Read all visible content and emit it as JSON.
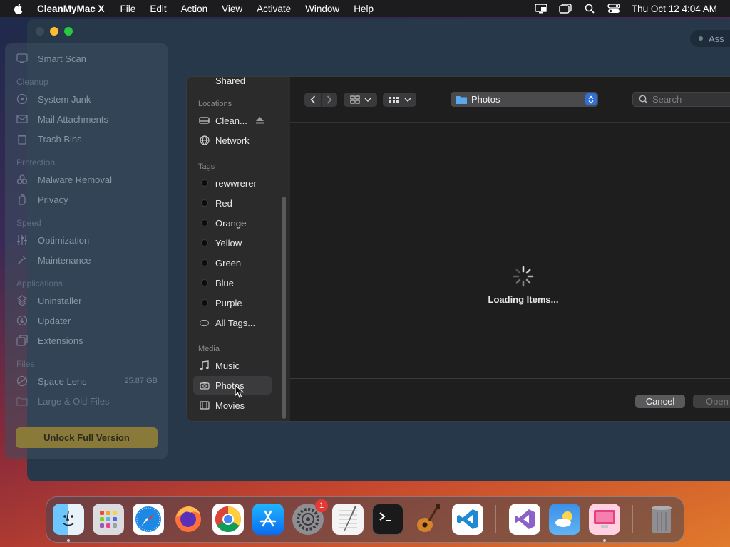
{
  "menubar": {
    "app_name": "CleanMyMac X",
    "menus": [
      "File",
      "Edit",
      "Action",
      "View",
      "Activate",
      "Window",
      "Help"
    ],
    "clock": "Thu Oct 12  4:04 AM"
  },
  "app": {
    "assistant_label": "Ass",
    "sidebar": {
      "smart_scan": "Smart Scan",
      "sections": {
        "cleanup": "Cleanup",
        "protection": "Protection",
        "speed": "Speed",
        "applications": "Applications",
        "files": "Files"
      },
      "items": {
        "system_junk": "System Junk",
        "mail_attachments": "Mail Attachments",
        "trash_bins": "Trash Bins",
        "malware_removal": "Malware Removal",
        "privacy": "Privacy",
        "optimization": "Optimization",
        "maintenance": "Maintenance",
        "uninstaller": "Uninstaller",
        "updater": "Updater",
        "extensions": "Extensions",
        "space_lens": "Space Lens",
        "large_old_files": "Large & Old Files"
      },
      "space_lens_size": "25.87 GB",
      "unlock_label": "Unlock Full Version"
    }
  },
  "dialog": {
    "sidebar": {
      "shared_label": "Shared",
      "locations_header": "Locations",
      "locations": [
        "Clean...",
        "Network"
      ],
      "tags_header": "Tags",
      "tags": [
        "rewwrerer",
        "Red",
        "Orange",
        "Yellow",
        "Green",
        "Blue",
        "Purple",
        "All Tags..."
      ],
      "media_header": "Media",
      "media": [
        "Music",
        "Photos",
        "Movies"
      ],
      "selected": "Photos"
    },
    "path_popup": "Photos",
    "search_placeholder": "Search",
    "loading_text": "Loading Items...",
    "cancel_label": "Cancel",
    "open_label": "Open"
  },
  "dock": {
    "apps": [
      "Finder",
      "Launchpad",
      "Safari",
      "Firefox",
      "Chrome",
      "App Store",
      "System Settings",
      "TextEdit",
      "Terminal",
      "GarageBand",
      "Visual Studio Code",
      "Visual Studio",
      "Weather",
      "CleanMyMac X",
      "Trash"
    ],
    "settings_badge": "1"
  },
  "colors": {
    "accent_blue": "#2f6fd6",
    "close": "#ff5f57",
    "minimize": "#febc2e",
    "zoom": "#28c840",
    "unlock": "#8a7a3a"
  }
}
